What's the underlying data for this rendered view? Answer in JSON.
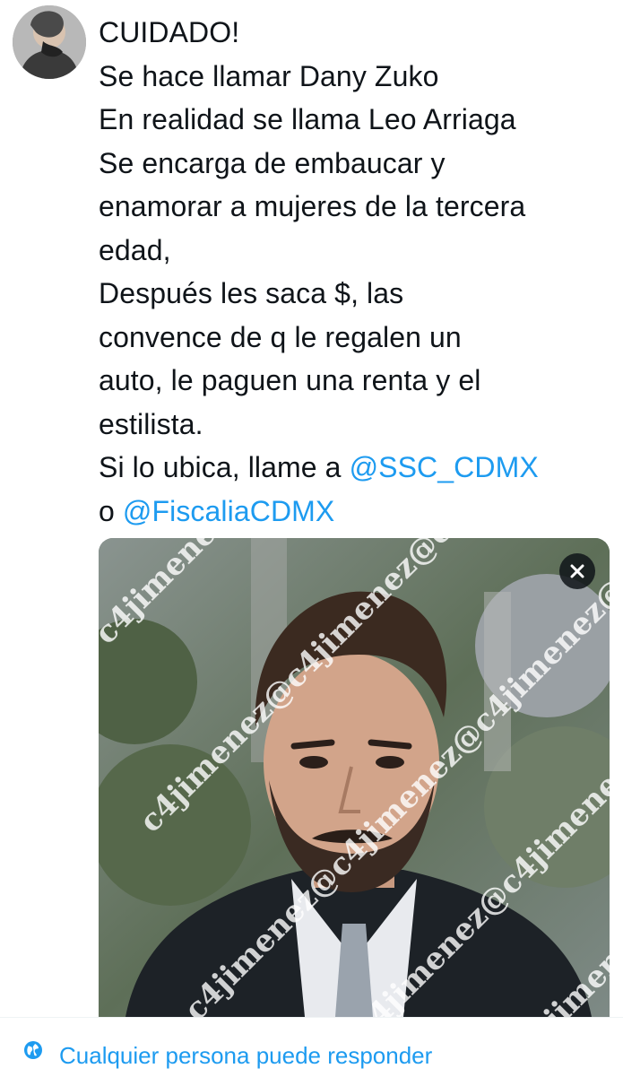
{
  "tweet": {
    "lines": [
      "CUIDADO!",
      "Se hace llamar Dany Zuko",
      "En realidad se llama Leo Arriaga",
      "Se encarga de embaucar y",
      "enamorar a mujeres de la tercera",
      "edad,",
      "Después les saca $, las",
      "convence de q le regalen un",
      "auto, le paguen una renta y el",
      "estilista."
    ],
    "line11_prefix": "Si lo ubica, llame a ",
    "mention1": "@SSC_CDMX",
    "line12_prefix": "o ",
    "mention2": "@FiscaliaCDMX"
  },
  "media": {
    "watermark_text": "c4jimenez@c4jimenez@c4jimenez@c4jimenez@c4jimenez@",
    "close_icon": "close-icon"
  },
  "reply": {
    "label": "Cualquier persona puede responder",
    "icon": "globe-icon"
  },
  "colors": {
    "accent": "#1d9bf0",
    "text": "#0f1419"
  }
}
